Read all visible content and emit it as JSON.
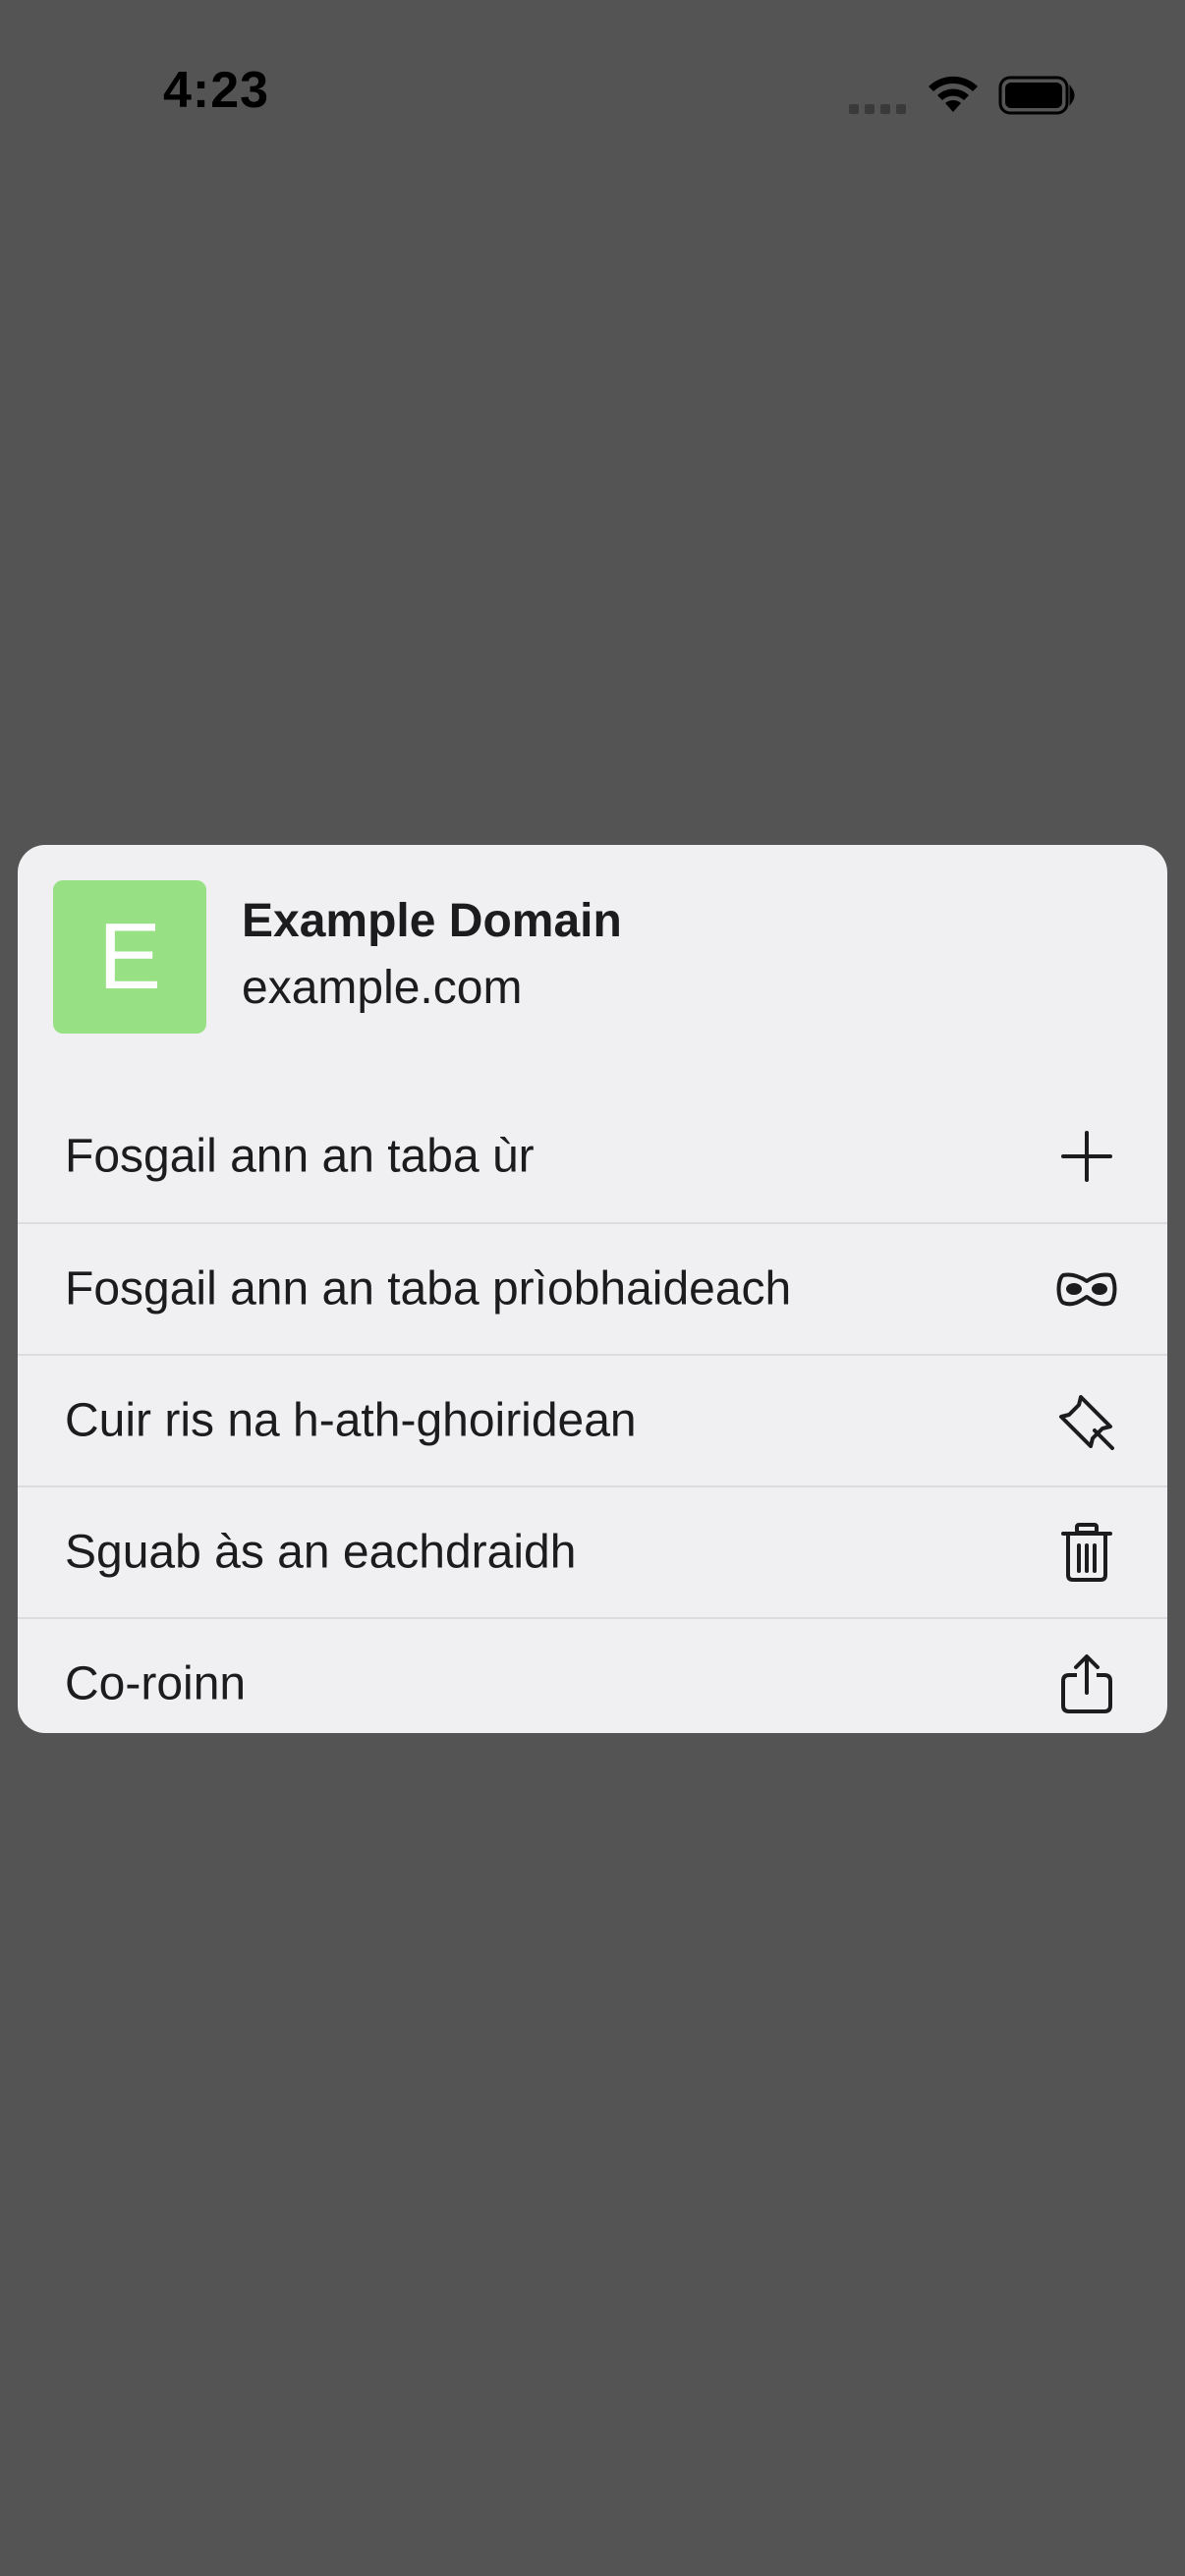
{
  "status_bar": {
    "time": "4:23",
    "icons": [
      "cellular-signal-icon",
      "wifi-icon",
      "battery-icon"
    ]
  },
  "preview": {
    "favicon_letter": "E",
    "favicon_color": "#97e083",
    "title": "Example Domain",
    "url": "example.com"
  },
  "menu": {
    "items": [
      {
        "label": "Fosgail ann an taba ùr",
        "icon": "plus-icon"
      },
      {
        "label": "Fosgail ann an taba prìobhaideach",
        "icon": "private-mask-icon"
      },
      {
        "label": "Cuir ris na h-ath-ghoiridean",
        "icon": "pin-icon"
      },
      {
        "label": "Sguab às an eachdraidh",
        "icon": "trash-icon"
      },
      {
        "label": "Co-roinn",
        "icon": "share-icon"
      }
    ]
  },
  "colors": {
    "backdrop": "#545454",
    "card": "#f0f0f2",
    "text": "#1c1c1e",
    "separator": "#dcdce0"
  }
}
